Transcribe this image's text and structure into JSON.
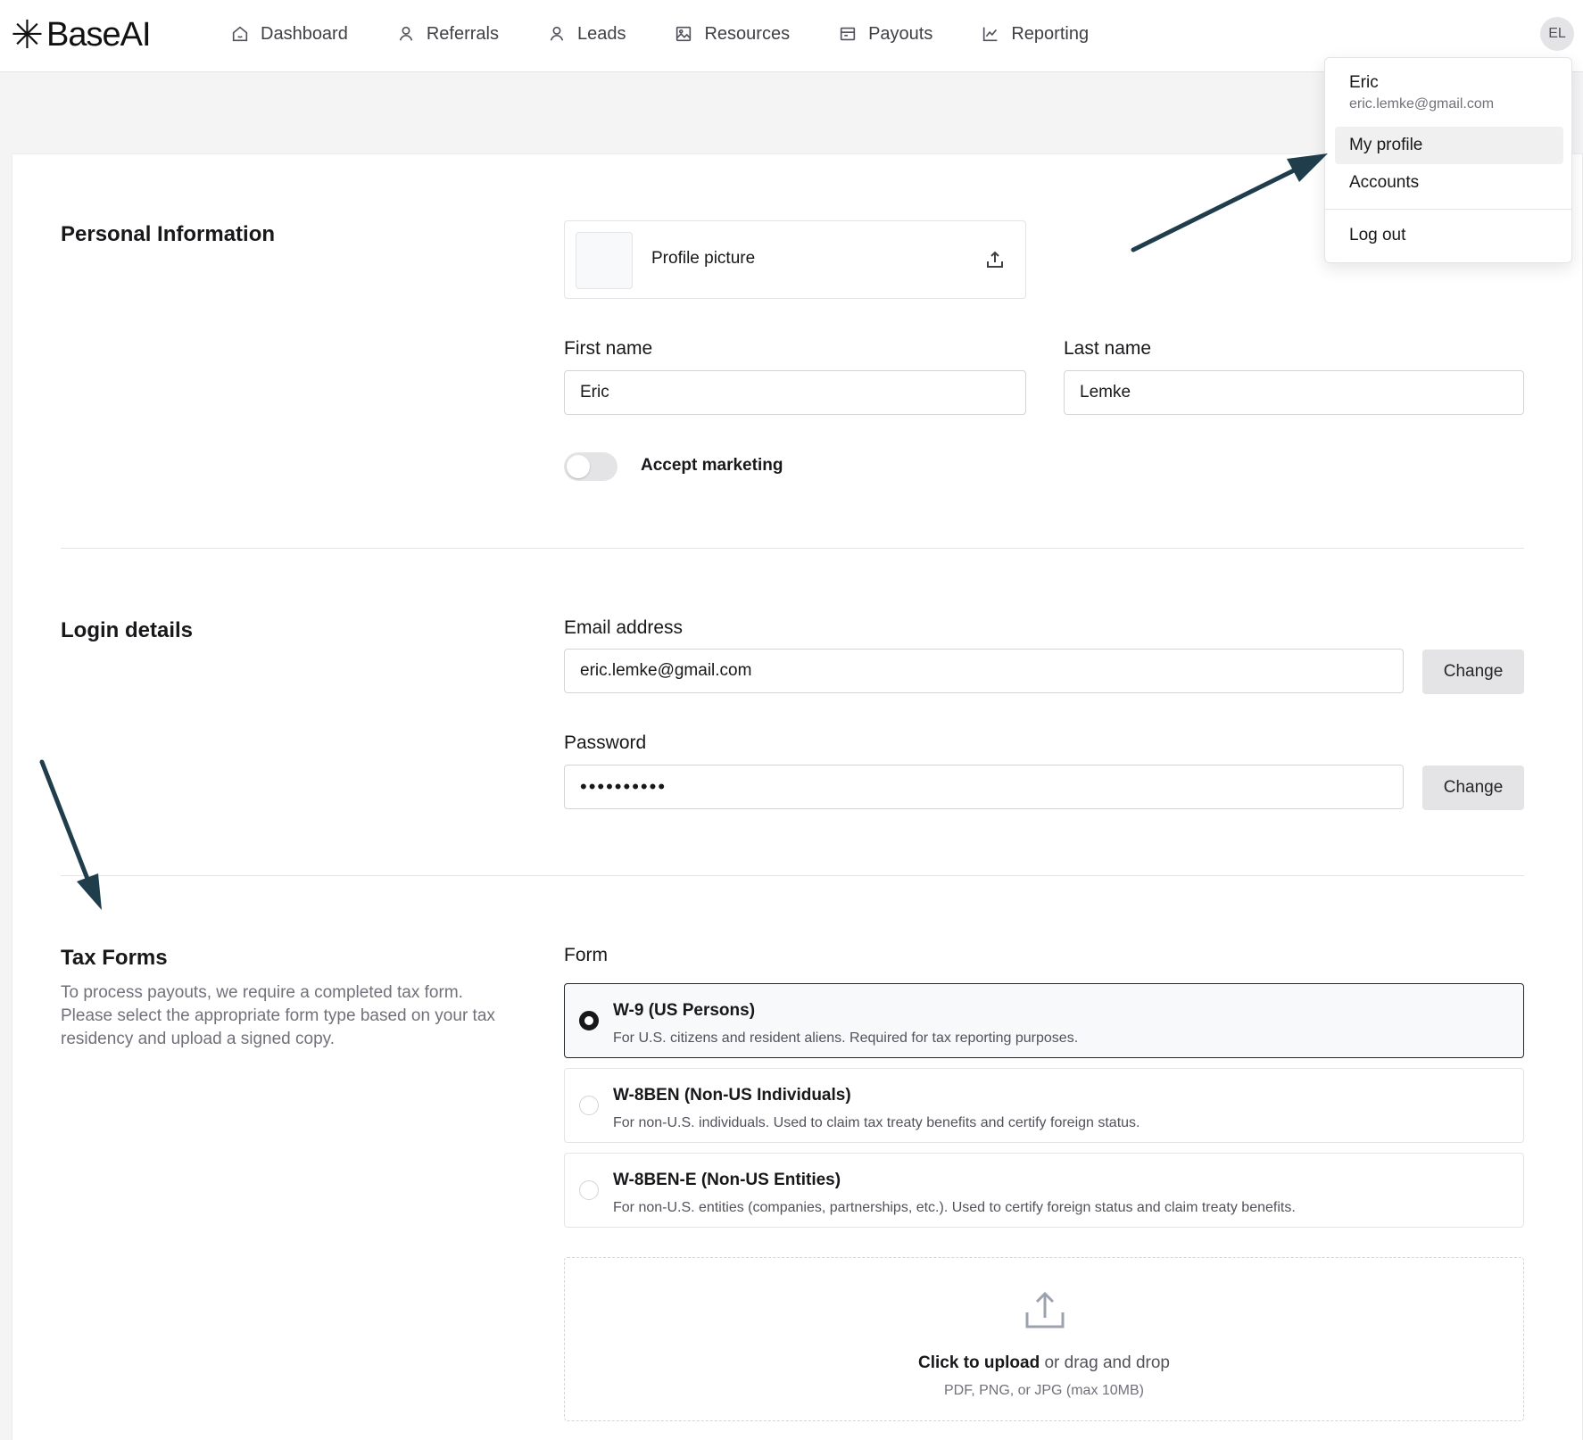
{
  "app": {
    "logo_mark": "✳",
    "logo_text": "BaseAI"
  },
  "nav": {
    "items": [
      {
        "label": "Dashboard",
        "icon": "home-icon"
      },
      {
        "label": "Referrals",
        "icon": "user-icon"
      },
      {
        "label": "Leads",
        "icon": "user-icon"
      },
      {
        "label": "Resources",
        "icon": "image-icon"
      },
      {
        "label": "Payouts",
        "icon": "wallet-icon"
      },
      {
        "label": "Reporting",
        "icon": "chart-icon"
      }
    ]
  },
  "user": {
    "initials": "EL",
    "name": "Eric",
    "email": "eric.lemke@gmail.com"
  },
  "user_menu": {
    "items": [
      {
        "label": "My profile",
        "active": true
      },
      {
        "label": "Accounts",
        "active": false
      },
      {
        "label": "Log out",
        "active": false
      }
    ]
  },
  "personal": {
    "title": "Personal Information",
    "profile_picture_label": "Profile picture",
    "first_name_label": "First name",
    "first_name_value": "Eric",
    "last_name_label": "Last name",
    "last_name_value": "Lemke",
    "accept_marketing_label": "Accept marketing",
    "accept_marketing": false
  },
  "login": {
    "title": "Login details",
    "email_label": "Email address",
    "email_value": "eric.lemke@gmail.com",
    "email_change": "Change",
    "password_label": "Password",
    "password_value": "••••••••••",
    "password_change": "Change"
  },
  "tax": {
    "title": "Tax Forms",
    "description": "To process payouts, we require a completed tax form. Please select the appropriate form type based on your tax residency and upload a signed copy.",
    "form_label": "Form",
    "options": [
      {
        "title": "W-9 (US Persons)",
        "desc": "For U.S. citizens and resident aliens. Required for tax reporting purposes.",
        "selected": true
      },
      {
        "title": "W-8BEN (Non-US Individuals)",
        "desc": "For non-U.S. individuals. Used to claim tax treaty benefits and certify foreign status.",
        "selected": false
      },
      {
        "title": "W-8BEN-E (Non-US Entities)",
        "desc": "For non-U.S. entities (companies, partnerships, etc.). Used to certify foreign status and claim treaty benefits.",
        "selected": false
      }
    ],
    "upload_click": "Click to upload",
    "upload_rest": " or drag and drop",
    "upload_hint": "PDF, PNG, or JPG (max 10MB)"
  },
  "colors": {
    "arrow": "#1f3d4a",
    "border": "#e4e4e7",
    "page_bg": "#f4f4f5"
  }
}
